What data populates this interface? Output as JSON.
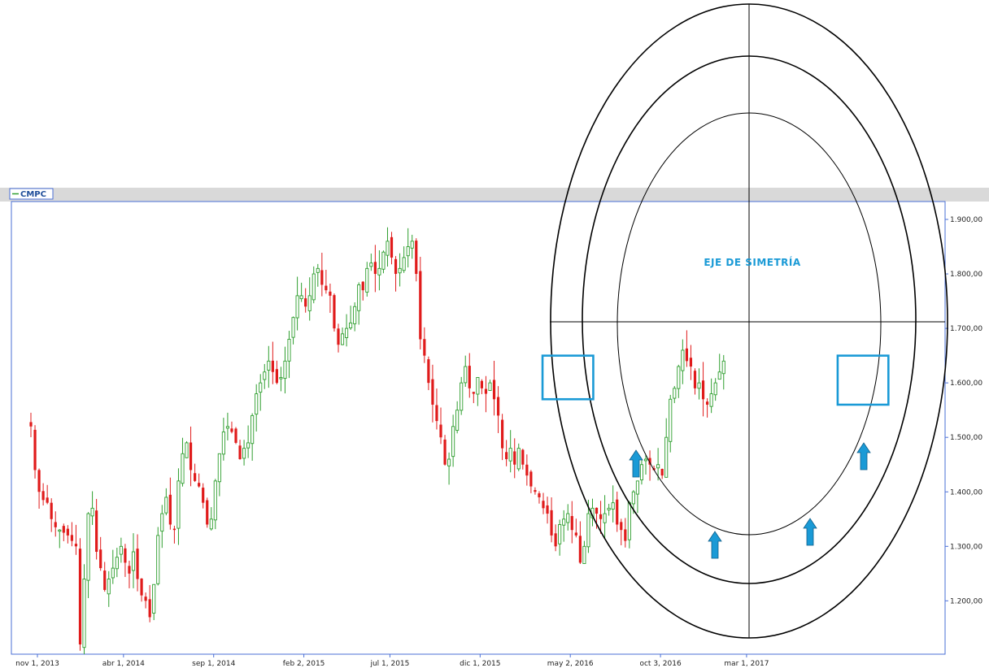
{
  "window": {
    "legend_label": "CMPC",
    "colors": {
      "up": "#2e9e2e",
      "down": "#e01b1b",
      "frame": "#4a6fd6",
      "accent": "#1a9ad6",
      "toolbar": "#d9d9d9"
    }
  },
  "chart_data": {
    "type": "candlestick",
    "title": "",
    "xlabel": "",
    "ylabel": "",
    "series": [
      {
        "name": "CMPC"
      }
    ],
    "ylim": [
      1140,
      1925
    ],
    "y_ticks": [
      "1.900,00",
      "1.800,00",
      "1.700,00",
      "1.600,00",
      "1.500,00",
      "1.400,00",
      "1.300,00",
      "1.200,00"
    ],
    "y_tick_values": [
      1900,
      1800,
      1700,
      1600,
      1500,
      1400,
      1300,
      1200
    ],
    "x_ticks": [
      "nov 1, 2013",
      "abr 1, 2014",
      "sep 1, 2014",
      "feb 2, 2015",
      "jul 1, 2015",
      "dic 1, 2015",
      "may 2, 2016",
      "oct 3, 2016",
      "mar 1, 2017"
    ],
    "x_tick_weeks": [
      0,
      21,
      43,
      65,
      86,
      108,
      130,
      152,
      173
    ],
    "candles": {
      "start_week": 0,
      "close": [
        1520,
        1440,
        1400,
        1385,
        1380,
        1350,
        1335,
        1330,
        1325,
        1320,
        1310,
        1300,
        1120,
        1240,
        1360,
        1370,
        1290,
        1260,
        1220,
        1240,
        1260,
        1280,
        1300,
        1270,
        1250,
        1290,
        1240,
        1210,
        1200,
        1170,
        1230,
        1320,
        1360,
        1390,
        1340,
        1330,
        1420,
        1470,
        1490,
        1440,
        1420,
        1410,
        1380,
        1340,
        1350,
        1420,
        1470,
        1510,
        1520,
        1510,
        1490,
        1460,
        1480,
        1490,
        1540,
        1580,
        1600,
        1620,
        1640,
        1620,
        1600,
        1610,
        1640,
        1680,
        1720,
        1760,
        1760,
        1740,
        1760,
        1800,
        1810,
        1780,
        1770,
        1760,
        1700,
        1670,
        1690,
        1700,
        1710,
        1740,
        1780,
        1770,
        1810,
        1820,
        1800,
        1810,
        1840,
        1860,
        1830,
        1800,
        1810,
        1830,
        1850,
        1860,
        1800,
        1680,
        1650,
        1600,
        1560,
        1530,
        1500,
        1450,
        1460,
        1520,
        1550,
        1600,
        1630,
        1590,
        1580,
        1610,
        1590,
        1580,
        1600,
        1570,
        1540,
        1480,
        1460,
        1480,
        1450,
        1480,
        1450,
        1430,
        1410,
        1400,
        1390,
        1370,
        1360,
        1320,
        1300,
        1340,
        1350,
        1360,
        1330,
        1320,
        1270,
        1300,
        1360,
        1370,
        1360,
        1350,
        1360,
        1370,
        1380,
        1340,
        1330,
        1310,
        1380,
        1400,
        1420,
        1450,
        1460,
        1450,
        1440,
        1450,
        1430,
        1500,
        1570,
        1590,
        1630,
        1660,
        1640,
        1630,
        1590,
        1600,
        1570,
        1560,
        1580,
        1600,
        1620,
        1640
      ],
      "volatility": 16,
      "max_week": 189
    },
    "annotations": {
      "text": "EJE DE SIMETRÍA"
    },
    "arrows_weeks": [
      138,
      160,
      180,
      204
    ],
    "highlight_boxes": [
      [
        126,
        136
      ],
      [
        198,
        208
      ]
    ],
    "highlight_price_ranges": [
      [
        1570,
        1650
      ],
      [
        1560,
        1650
      ]
    ],
    "symmetry_axis": {
      "week": 163,
      "price": 1665
    },
    "grid": false,
    "legend_position": "top-left"
  }
}
